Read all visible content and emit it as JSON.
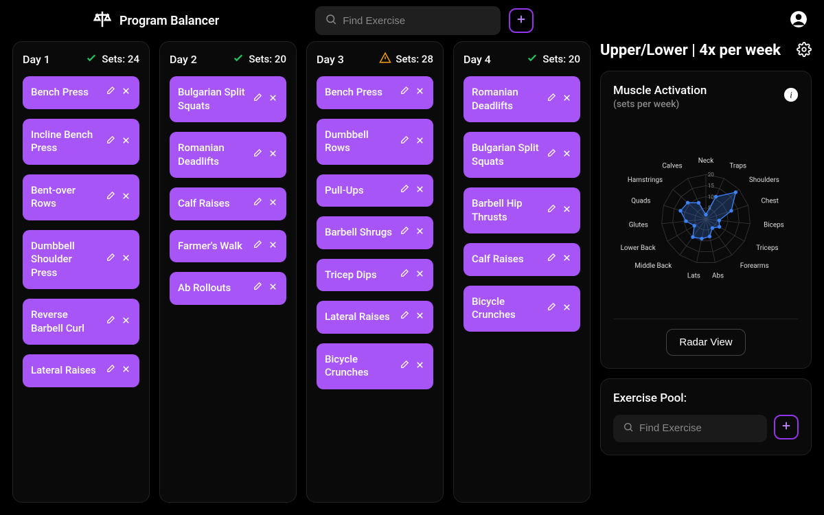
{
  "header": {
    "app_title": "Program Balancer",
    "search_placeholder": "Find Exercise"
  },
  "program_title": "Upper/Lower | 4x per week",
  "days": [
    {
      "label": "Day 1",
      "sets_label": "Sets: 24",
      "status": "ok",
      "exercises": [
        "Bench Press",
        "Incline Bench Press",
        "Bent-over Rows",
        "Dumbbell Shoulder Press",
        "Reverse Barbell Curl",
        "Lateral Raises"
      ]
    },
    {
      "label": "Day 2",
      "sets_label": "Sets: 20",
      "status": "ok",
      "exercises": [
        "Bulgarian Split Squats",
        "Romanian Deadlifts",
        "Calf Raises",
        "Farmer's Walk",
        "Ab Rollouts"
      ]
    },
    {
      "label": "Day 3",
      "sets_label": "Sets: 28",
      "status": "warn",
      "exercises": [
        "Bench Press",
        "Dumbbell Rows",
        "Pull-Ups",
        "Barbell Shrugs",
        "Tricep Dips",
        "Lateral Raises",
        "Bicycle Crunches"
      ]
    },
    {
      "label": "Day 4",
      "sets_label": "Sets: 20",
      "status": "ok",
      "exercises": [
        "Romanian Deadlifts",
        "Bulgarian Split Squats",
        "Barbell Hip Thrusts",
        "Calf Raises",
        "Bicycle Crunches"
      ]
    }
  ],
  "muscle_panel": {
    "title": "Muscle Activation",
    "subtitle": "(sets per week)",
    "view_button": "Radar View"
  },
  "pool_panel": {
    "title": "Exercise Pool:",
    "search_placeholder": "Find Exercise"
  },
  "chart_data": {
    "type": "radar",
    "title": "Muscle Activation (sets per week)",
    "axis_max": 20,
    "ticks": [
      5,
      10,
      15,
      20
    ],
    "categories": [
      "Neck",
      "Traps",
      "Shoulders",
      "Chest",
      "Biceps",
      "Triceps",
      "Forearms",
      "Abs",
      "Lats",
      "Middle Back",
      "Lower Back",
      "Glutes",
      "Quads",
      "Hamstrings",
      "Calves"
    ],
    "values": [
      2,
      11,
      18,
      12,
      6,
      7,
      5,
      8,
      9,
      10,
      6,
      9,
      12,
      11,
      8
    ]
  }
}
